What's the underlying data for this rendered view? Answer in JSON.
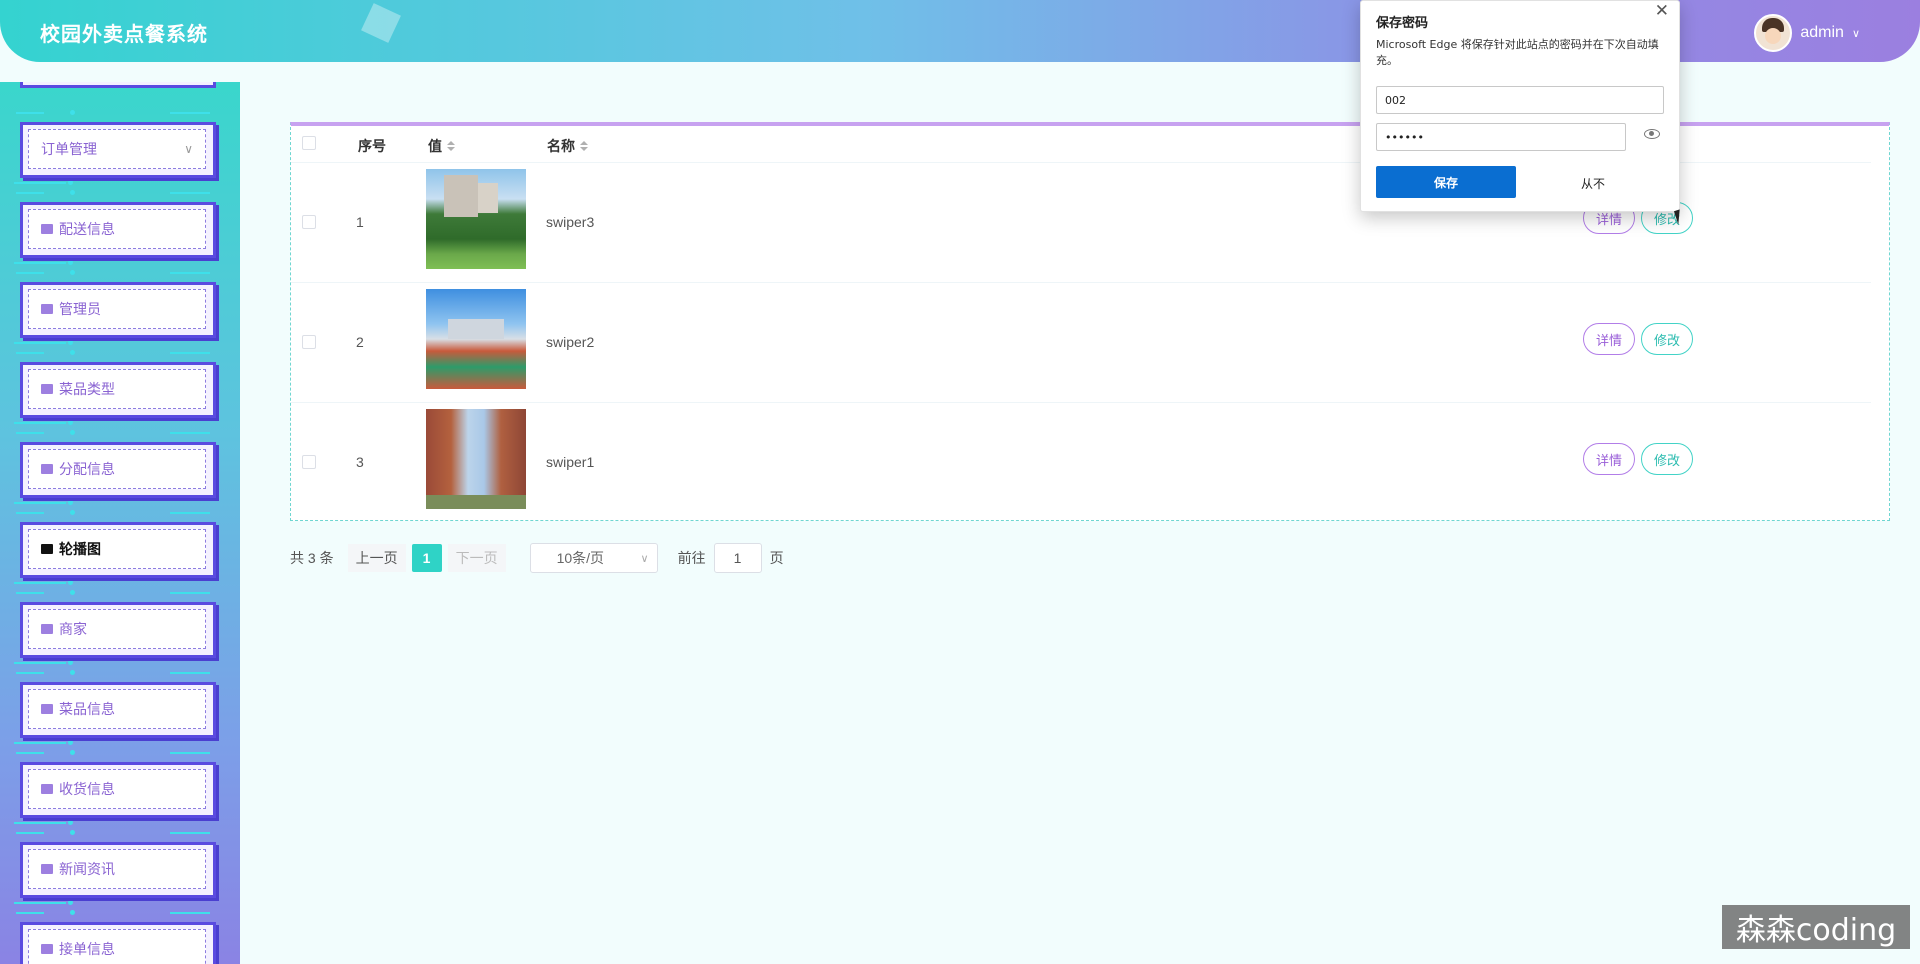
{
  "header": {
    "title": "校园外卖点餐系统",
    "user_name": "admin",
    "user_caret": "∨"
  },
  "sidebar": {
    "items": [
      {
        "label": "订单管理",
        "icon": "none",
        "has_chevron": true,
        "active": false
      },
      {
        "label": "配送信息",
        "icon": "card-icon",
        "active": false
      },
      {
        "label": "管理员",
        "icon": "user-icon",
        "active": false
      },
      {
        "label": "菜品类型",
        "icon": "thumb-icon",
        "active": false
      },
      {
        "label": "分配信息",
        "icon": "square-icon",
        "active": false
      },
      {
        "label": "轮播图",
        "icon": "image-icon",
        "active": true
      },
      {
        "label": "商家",
        "icon": "person-icon",
        "active": false
      },
      {
        "label": "菜品信息",
        "icon": "folder-icon",
        "active": false
      },
      {
        "label": "收货信息",
        "icon": "box-icon",
        "active": false
      },
      {
        "label": "新闻资讯",
        "icon": "news-icon",
        "active": false
      },
      {
        "label": "接单信息",
        "icon": "list-icon",
        "active": false
      }
    ],
    "chevron": "∨"
  },
  "table": {
    "columns": {
      "index": "序号",
      "value": "值",
      "name": "名称"
    },
    "rows": [
      {
        "index": "1",
        "name": "swiper3",
        "image": "campus-building-lawn"
      },
      {
        "index": "2",
        "name": "swiper2",
        "image": "campus-track-field"
      },
      {
        "index": "3",
        "name": "swiper1",
        "image": "campus-brick-buildings"
      }
    ],
    "detail_label": "详情",
    "edit_label": "修改"
  },
  "pagination": {
    "total": "共 3 条",
    "prev": "上一页",
    "current": "1",
    "next": "下一页",
    "page_size": "10条/页",
    "goto_prefix": "前往",
    "goto_value": "1",
    "goto_suffix": "页",
    "caret": "∨"
  },
  "password_popup": {
    "title": "保存密码",
    "close": "✕",
    "description": "Microsoft Edge 将保存针对此站点的密码并在下次自动填充。",
    "username": "002",
    "password_mask": "••••••",
    "save_label": "保存",
    "never_label": "从不"
  },
  "watermark": "森森coding",
  "colors": {
    "accent_teal": "#2fd3c6",
    "accent_purple": "#9a5fd8",
    "edge_blue": "#0a6ed1"
  }
}
